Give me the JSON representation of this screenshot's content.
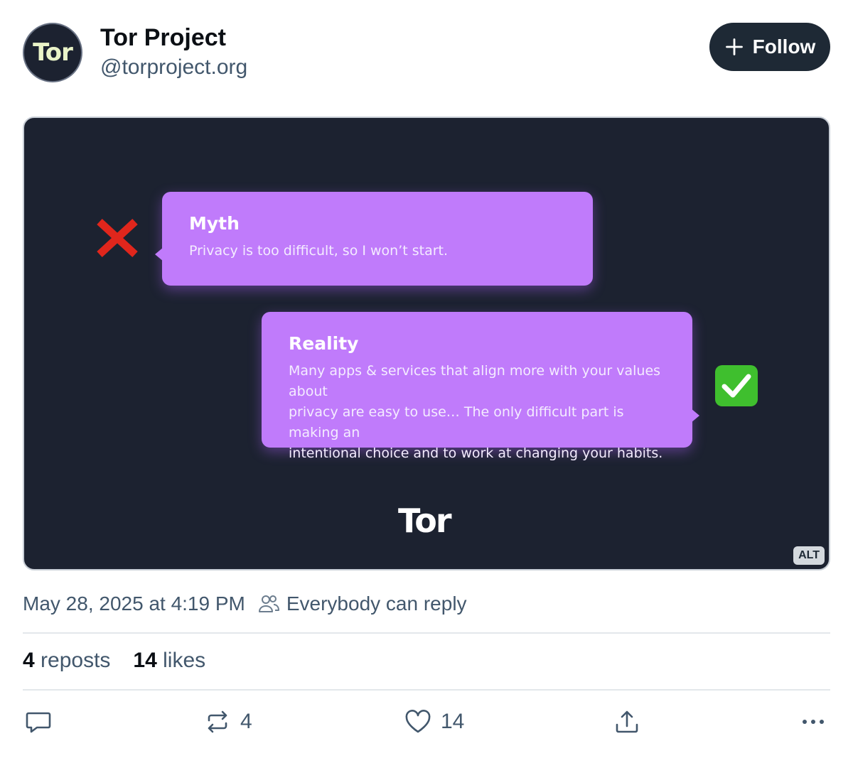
{
  "author": {
    "avatar_text": "Tor",
    "name": "Tor Project",
    "handle": "@torproject.org"
  },
  "follow_button": {
    "label": "Follow"
  },
  "media": {
    "myth": {
      "title": "Myth",
      "text": "Privacy is too difficult, so I won’t start."
    },
    "reality": {
      "title": "Reality",
      "lines": [
        "Many apps & services that align more with your values about",
        "privacy are easy to use… The only difficult part is making an",
        "intentional choice and to work at changing your habits."
      ]
    },
    "logo_text": "Tor",
    "alt_badge": "ALT"
  },
  "meta": {
    "timestamp": "May 28, 2025 at 4:19 PM",
    "reply_setting": "Everybody can reply"
  },
  "stats": {
    "reposts_count": "4",
    "reposts_label": "reposts",
    "likes_count": "14",
    "likes_label": "likes"
  },
  "actions": {
    "repost_count": "4",
    "like_count": "14"
  },
  "colors": {
    "bubble": "#c07bfb",
    "media_bg": "#1c2230",
    "button_bg": "#1e2935"
  }
}
